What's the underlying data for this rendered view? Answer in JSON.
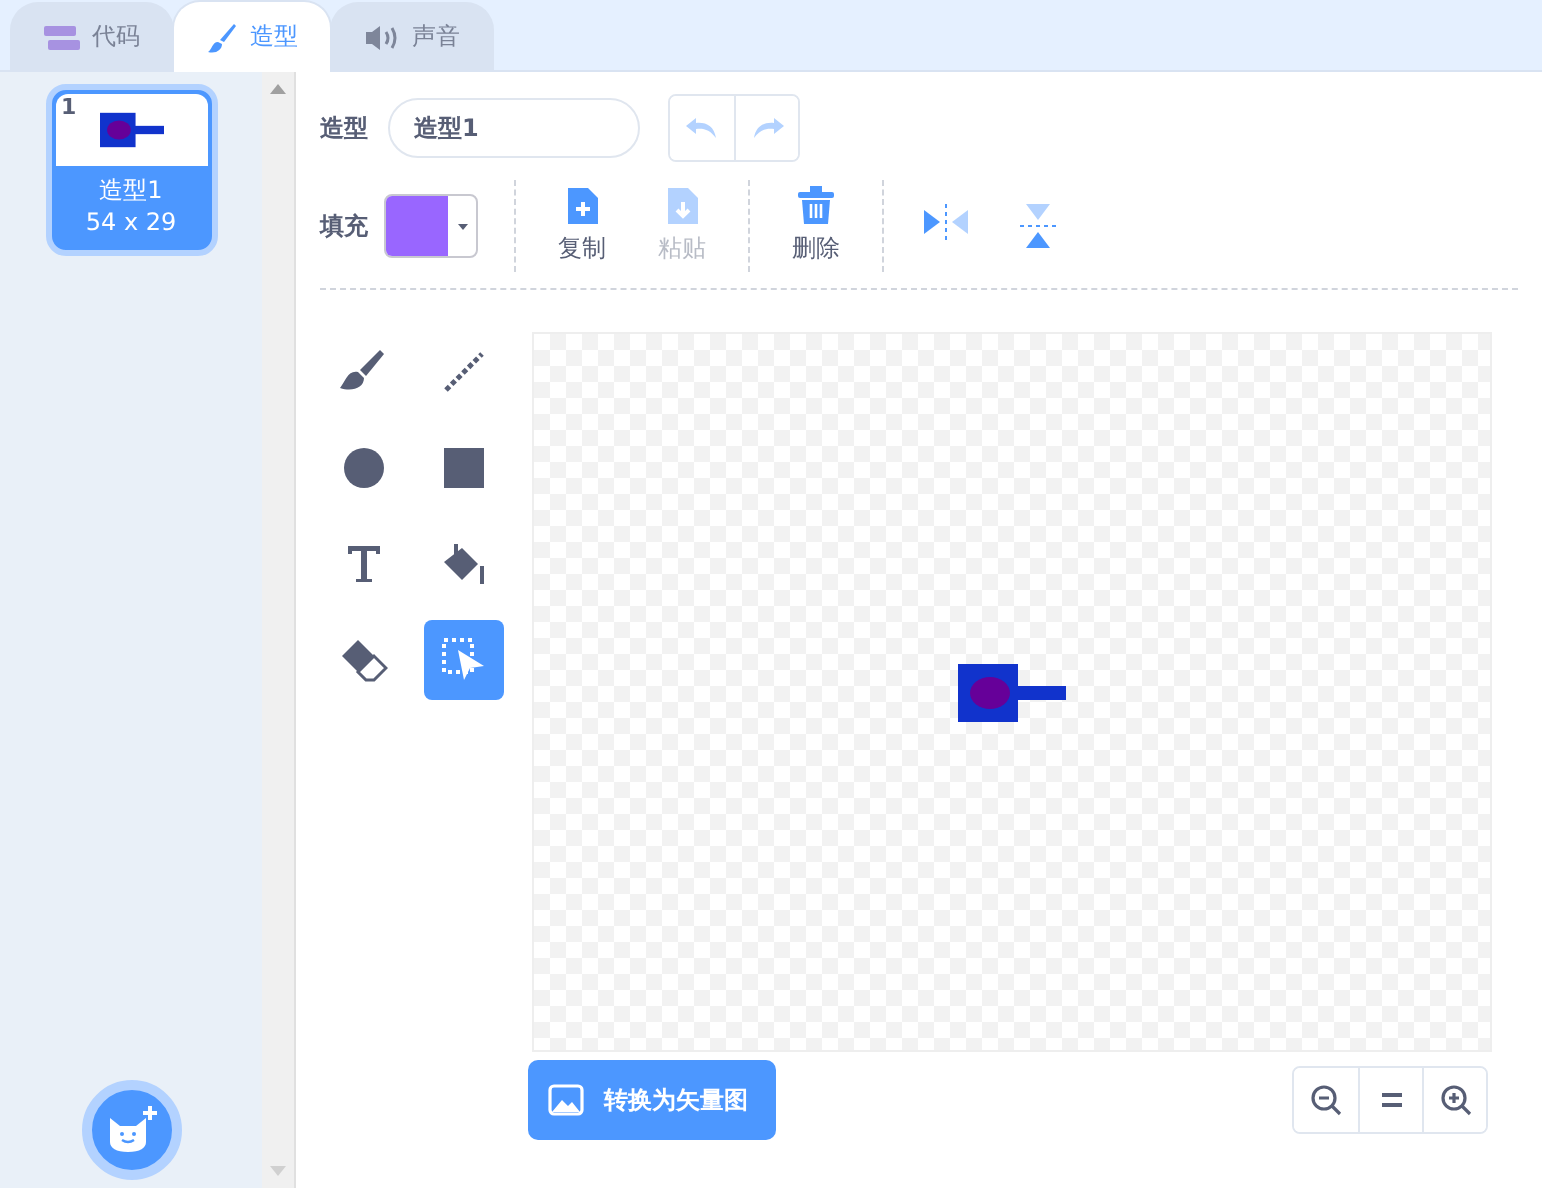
{
  "tabs": [
    {
      "label": "代码",
      "kind": "code",
      "selected": false
    },
    {
      "label": "造型",
      "kind": "brush",
      "selected": true
    },
    {
      "label": "声音",
      "kind": "sound",
      "selected": false
    }
  ],
  "costumes": [
    {
      "number": "1",
      "name": "造型1",
      "size": "54 x 29",
      "selected": true
    }
  ],
  "costume_name": {
    "label": "造型",
    "value": "造型1"
  },
  "history": [
    {
      "kind": "undo",
      "disabled": true
    },
    {
      "kind": "redo",
      "disabled": true
    }
  ],
  "fill": {
    "label": "填充",
    "color": "#9966ff"
  },
  "actions": [
    {
      "kind": "copy",
      "label": "复制",
      "disabled": false
    },
    {
      "kind": "paste",
      "label": "粘贴",
      "disabled": true
    },
    {
      "kind": "delete",
      "label": "删除",
      "disabled": false
    }
  ],
  "flips": [
    {
      "kind": "flip-horizontal"
    },
    {
      "kind": "flip-vertical"
    }
  ],
  "tools": [
    {
      "kind": "brush",
      "selected": false
    },
    {
      "kind": "line",
      "selected": false
    },
    {
      "kind": "circle",
      "selected": false
    },
    {
      "kind": "rectangle",
      "selected": false
    },
    {
      "kind": "text",
      "selected": false
    },
    {
      "kind": "fill",
      "selected": false
    },
    {
      "kind": "eraser",
      "selected": false
    },
    {
      "kind": "select",
      "selected": true
    }
  ],
  "convert_button": {
    "label": "转换为矢量图"
  },
  "zoom": [
    {
      "kind": "zoom-out"
    },
    {
      "kind": "reset"
    },
    {
      "kind": "zoom-in"
    }
  ]
}
